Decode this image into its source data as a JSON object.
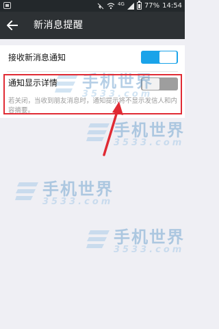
{
  "status_bar": {
    "network": "4G",
    "battery_percent": "77%",
    "time": "14:54",
    "battery_level": 0.77
  },
  "app_bar": {
    "back_icon": "arrow-left-icon",
    "title": "新消息提醒"
  },
  "settings": {
    "receive_new_message": {
      "label": "接收新消息通知",
      "enabled": true
    },
    "show_details": {
      "label": "通知显示详情",
      "enabled": false,
      "description": "若关闭，当收到朋友消息时，通知提示将不显示发信人和内容摘要。"
    }
  },
  "watermark": {
    "text": "手机世界",
    "sub": "3533.com"
  },
  "colors": {
    "status_bar_bg": "#23282b",
    "app_bar_bg": "#2d3134",
    "toggle_on": "#1aa3e9",
    "toggle_off": "#9e9e9e",
    "highlight": "#e02a33",
    "page_bg": "#efeff4"
  }
}
